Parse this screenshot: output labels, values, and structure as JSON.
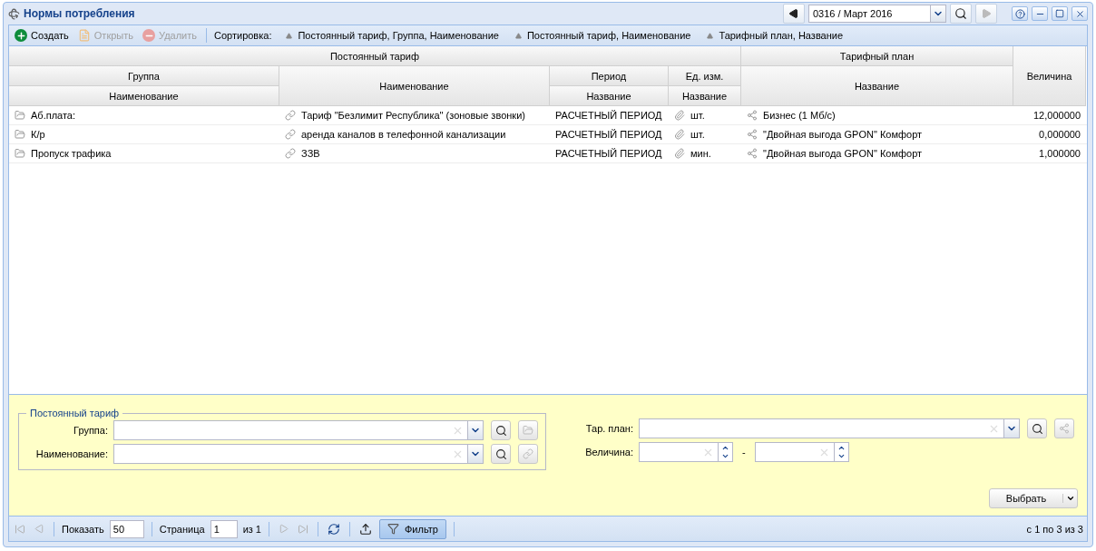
{
  "window": {
    "title": "Нормы потребления",
    "period": "0316 / Март 2016"
  },
  "toolbar": {
    "buttons": [
      {
        "kind": "create",
        "label": "Создать",
        "disabled": false
      },
      {
        "kind": "open",
        "label": "Открыть",
        "disabled": true
      },
      {
        "kind": "delete",
        "label": "Удалить",
        "disabled": true
      }
    ],
    "sort_label": "Сортировка:",
    "sorts": [
      "Постоянный тариф, Группа, Наименование",
      "Постоянный тариф, Наименование",
      "Тарифный план, Название"
    ]
  },
  "table": {
    "group_headers": [
      "Постоянный тариф",
      "Тарифный план"
    ],
    "columns": [
      "Группа",
      "Наименование",
      "Наименование",
      "Период",
      "Название",
      "Ед. изм.",
      "Название",
      "Название",
      "Величина"
    ],
    "rows": [
      {
        "group": "Аб.плата:",
        "name": "Тариф \"Безлимит Республика\" (зоновые звонки)",
        "period": "РАСЧЕТНЫЙ ПЕРИОД",
        "unit": "шт.",
        "plan": "Бизнес (1 Мб/с)",
        "value": "12,000000"
      },
      {
        "group": "К/р",
        "name": "аренда каналов в телефонной канализации",
        "period": "РАСЧЕТНЫЙ ПЕРИОД",
        "unit": "шт.",
        "plan": "\"Двойная выгода GPON\" Комфорт",
        "value": "0,000000"
      },
      {
        "group": "Пропуск трафика",
        "name": "ЗЗВ",
        "period": "РАСЧЕТНЫЙ ПЕРИОД",
        "unit": "мин.",
        "plan": "\"Двойная выгода GPON\" Комфорт",
        "value": "1,000000"
      }
    ]
  },
  "filter": {
    "legend": "Постоянный тариф",
    "fields": [
      "Группа:",
      "Наименование:"
    ],
    "plan_label": "Тар. план:",
    "value_label": "Величина:",
    "range_separator": "-",
    "apply_button": "Выбрать"
  },
  "paging": {
    "show_label": "Показать",
    "page_size": "50",
    "page_label": "Страница",
    "page": "1",
    "page_count": "из 1",
    "filter_button": {
      "label": "Фильтр",
      "selected": true
    },
    "summary": "с 1 по 3 из 3"
  }
}
